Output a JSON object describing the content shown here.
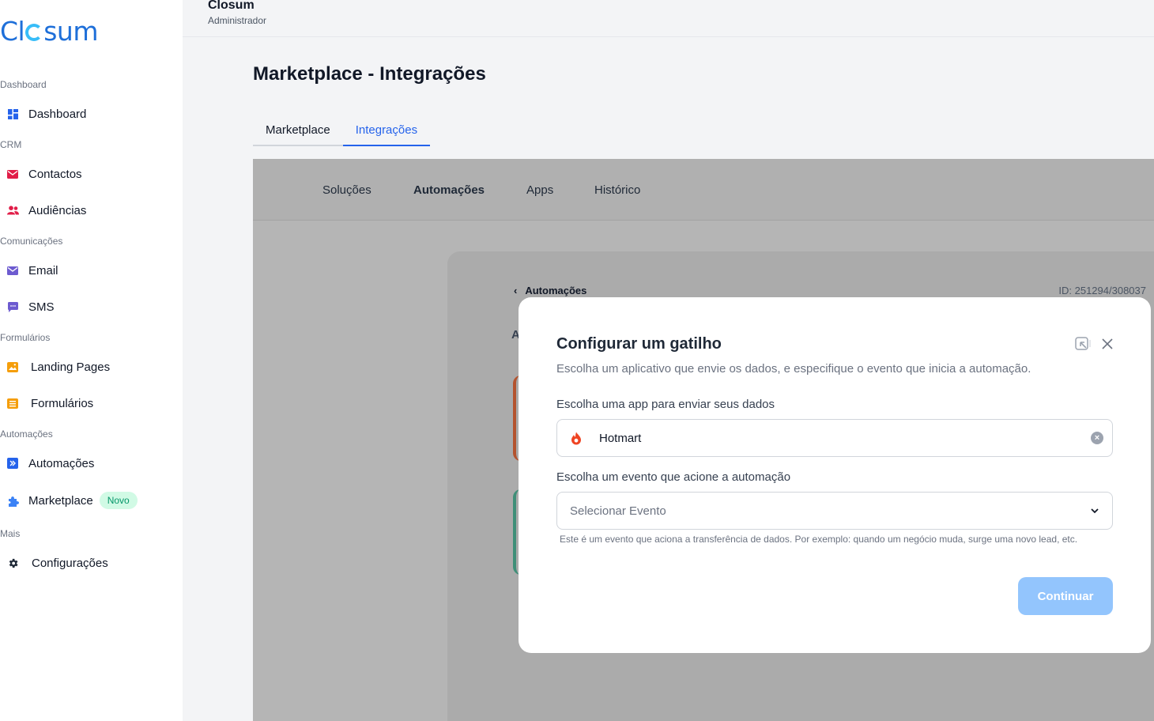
{
  "brand": {
    "logo_pre": "Cl",
    "logo_post": "sum"
  },
  "sidebar": {
    "sections": [
      "Dashboard",
      "CRM",
      "Comunicações",
      "Formulários",
      "Automações",
      "Mais"
    ],
    "items": [
      {
        "label": "Dashboard",
        "icon": "dashboard-icon",
        "color": "#2563eb"
      },
      {
        "label": "Contactos",
        "icon": "envelope-icon",
        "color": "#e11d48"
      },
      {
        "label": "Audiências",
        "icon": "users-icon",
        "color": "#e11d48"
      },
      {
        "label": "Email",
        "icon": "mail-icon",
        "color": "#6d5bd0"
      },
      {
        "label": "SMS",
        "icon": "chat-icon",
        "color": "#6d5bd0"
      },
      {
        "label": "Landing Pages",
        "icon": "image-icon",
        "color": "#f59e0b"
      },
      {
        "label": "Formulários",
        "icon": "form-icon",
        "color": "#f59e0b"
      },
      {
        "label": "Automações",
        "icon": "automation-icon",
        "color": "#2563eb"
      },
      {
        "label": "Marketplace",
        "icon": "puzzle-icon",
        "color": "#3b82f6",
        "badge": "Novo"
      },
      {
        "label": "Configurações",
        "icon": "gear-icon",
        "color": "#1f2937"
      }
    ]
  },
  "header": {
    "org": "Closum",
    "role": "Administrador"
  },
  "page": {
    "title": "Marketplace - Integrações",
    "tabs": [
      {
        "label": "Marketplace",
        "active": false
      },
      {
        "label": "Integrações",
        "active": true
      }
    ]
  },
  "subnav": [
    {
      "label": "Soluções"
    },
    {
      "label": "Automações",
      "active": true
    },
    {
      "label": "Apps"
    },
    {
      "label": "Histórico"
    }
  ],
  "card": {
    "breadcrumb": "Automações",
    "id_text": "ID: 251294/308037",
    "stub_letter": "A"
  },
  "modal": {
    "title": "Configurar um gatilho",
    "subtitle": "Escolha um aplicativo que envie os dados, e especifique o evento que inicia a automação.",
    "app_label": "Escolha uma app para enviar seus dados",
    "app_value": "Hotmart",
    "event_label": "Escolha um evento que acione a automação",
    "event_placeholder": "Selecionar Evento",
    "help_text": "Este é um evento que aciona a transferência de dados. Por exemplo: quando um negócio muda, surge uma novo lead, etc.",
    "continue_label": "Continuar"
  },
  "colors": {
    "accent": "#2563eb",
    "button_disabled": "#93c5fd",
    "hotmart": "#ef4423",
    "badge_bg": "#d1fae5",
    "badge_text": "#059669"
  }
}
